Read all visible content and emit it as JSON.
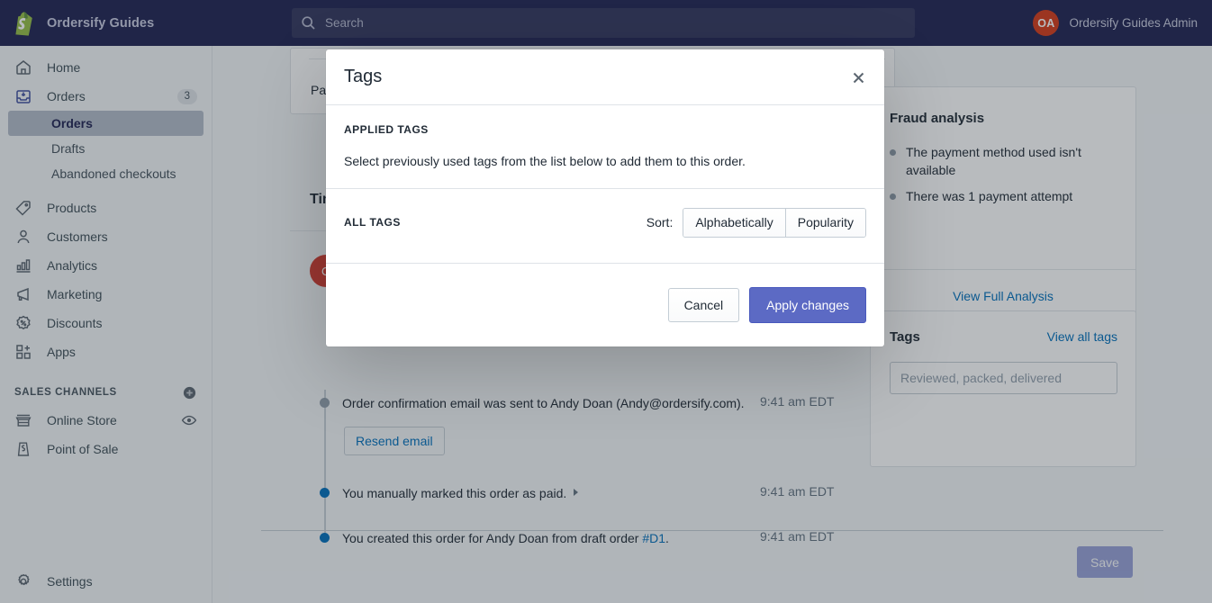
{
  "topbar": {
    "brand": "Ordersify Guides",
    "brand_icon": "shopify-bag-icon",
    "search_placeholder": "Search",
    "search_icon": "search-icon",
    "account_initials": "OA",
    "account_name": "Ordersify Guides Admin",
    "background": "#1f2252",
    "avatar_color": "#d63a18"
  },
  "sidebar": {
    "items": [
      {
        "label": "Home",
        "icon": "home-icon",
        "badge": ""
      },
      {
        "label": "Orders",
        "icon": "orders-inbox-icon",
        "badge": "3"
      },
      {
        "label": "Products",
        "icon": "tag-icon",
        "badge": ""
      },
      {
        "label": "Customers",
        "icon": "person-icon",
        "badge": ""
      },
      {
        "label": "Analytics",
        "icon": "bar-chart-icon",
        "badge": ""
      },
      {
        "label": "Marketing",
        "icon": "megaphone-icon",
        "badge": ""
      },
      {
        "label": "Discounts",
        "icon": "discount-percent-icon",
        "badge": ""
      },
      {
        "label": "Apps",
        "icon": "apps-grid-plus-icon",
        "badge": ""
      }
    ],
    "orders_sub": [
      {
        "label": "Orders",
        "active": true
      },
      {
        "label": "Drafts",
        "active": false
      },
      {
        "label": "Abandoned checkouts",
        "active": false
      }
    ],
    "sales_channels_heading": "SALES CHANNELS",
    "sales_channels_add_icon": "plus-circle-icon",
    "sales_channels": [
      {
        "label": "Online Store",
        "icon": "store-icon",
        "trailing_icon": "eye-icon"
      },
      {
        "label": "Point of Sale",
        "icon": "pos-icon",
        "trailing_icon": ""
      }
    ],
    "settings": {
      "label": "Settings",
      "icon": "gear-icon"
    }
  },
  "page": {
    "paid_card_label": "Paid",
    "timeline_title": "Timeline",
    "timeline_avatar_initial": "O",
    "timeline": [
      {
        "text": "Order confirmation email was sent to Andy Doan (Andy@ordersify.com).",
        "time": "9:41 am EDT",
        "dot": "hollow",
        "button": "Resend email"
      },
      {
        "text": "You manually marked this order as paid.",
        "time": "9:41 am EDT",
        "dot": "filled",
        "has_caret": true
      },
      {
        "text_before": "You created this order for Andy Doan from draft order ",
        "link": "#D1",
        "text_after": ".",
        "time": "9:41 am EDT",
        "dot": "filled"
      }
    ],
    "save_label": "Save",
    "fraud": {
      "title": "Fraud analysis",
      "items": [
        "The payment method used isn't available",
        "There was 1 payment attempt"
      ],
      "link": "View Full Analysis"
    },
    "tags_card": {
      "title": "Tags",
      "view_all": "View all tags",
      "input_placeholder": "Reviewed, packed, delivered"
    }
  },
  "modal": {
    "title": "Tags",
    "close_icon": "close-icon",
    "applied_tags_label": "APPLIED TAGS",
    "applied_tags_desc": "Select previously used tags from the list below to add them to this order.",
    "all_tags_label": "ALL TAGS",
    "sort_label": "Sort:",
    "sort_options": [
      {
        "label": "Alphabetically"
      },
      {
        "label": "Popularity"
      }
    ],
    "cancel_label": "Cancel",
    "apply_label": "Apply changes",
    "primary_color": "#5c6ac4"
  }
}
